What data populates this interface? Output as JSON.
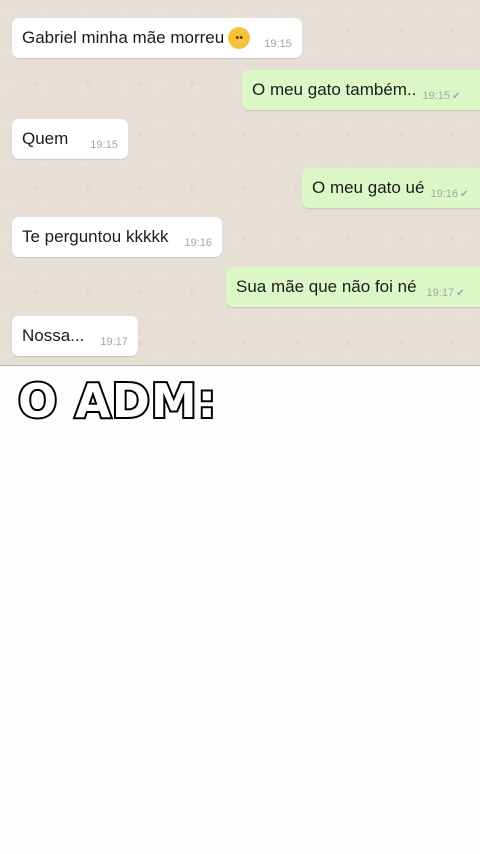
{
  "messages": [
    {
      "direction": "in",
      "text": "Gabriel minha mãe morreu",
      "emoji": "crying-face",
      "time": "19:15"
    },
    {
      "direction": "out",
      "text": "O meu gato também..",
      "time": "19:15"
    },
    {
      "direction": "in",
      "text": "Quem",
      "time": "19:15"
    },
    {
      "direction": "out",
      "text": "O meu gato ué",
      "time": "19:16"
    },
    {
      "direction": "in",
      "text": "Te perguntou kkkkk",
      "time": "19:16"
    },
    {
      "direction": "out",
      "text": "Sua mãe que não foi né",
      "time": "19:17"
    },
    {
      "direction": "in",
      "text": "Nossa...",
      "time": "19:17"
    }
  ],
  "caption": "O ADM:",
  "colors": {
    "chat_background": "#e6dfd6",
    "incoming_bubble": "#ffffff",
    "outgoing_bubble": "#dcf8c6",
    "lower_background": "#fdfcfe"
  }
}
